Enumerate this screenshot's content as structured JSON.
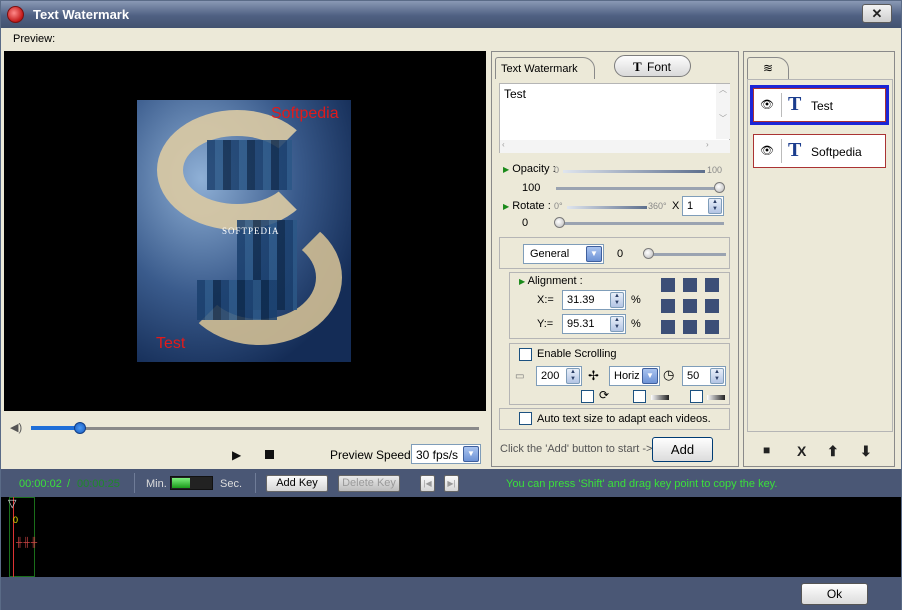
{
  "window": {
    "title": "Text Watermark",
    "close_glyph": "✕"
  },
  "menu": {
    "preview_label": "Preview:"
  },
  "preview": {
    "watermark_softpedia": "Softpedia",
    "watermark_test": "Test",
    "image_caption": "SOFTPEDIA",
    "seek_position": 0.11,
    "preview_speed_label": "Preview Speed:",
    "preview_speed_value": "30 fps/s",
    "watermark_color": "#e21a1a"
  },
  "tabs": {
    "text_watermark": "Text Watermark",
    "font": "Font",
    "font_icon": "T"
  },
  "text_editor": {
    "value": "Test"
  },
  "opacity": {
    "label": "Opacity",
    "min": "0",
    "max": "100",
    "value": "100",
    "level": 1.0
  },
  "rotate": {
    "label": "Rotate",
    "min": "0°",
    "max": "360°",
    "x_label": "X",
    "times_value": "1",
    "value": "0",
    "level": 0.0
  },
  "blend": {
    "mode": "General",
    "value": "0",
    "level": 0.0
  },
  "alignment": {
    "label": "Alignment :",
    "x_label": "X:=",
    "x_value": "31.39",
    "y_label": "Y:=",
    "y_value": "95.31",
    "unit": "%"
  },
  "scrolling": {
    "enable_label": "Enable Scrolling",
    "enabled": false,
    "distance": "200",
    "direction": "Horiz",
    "speed": "50"
  },
  "auto_size": {
    "label": "Auto text size to adapt each videos.",
    "checked": false
  },
  "add": {
    "hint": "Click the 'Add' button to start ->",
    "button": "Add"
  },
  "layers": {
    "items": [
      {
        "name": "Test",
        "selected": true
      },
      {
        "name": "Softpedia",
        "selected": false
      }
    ],
    "tools": {
      "lock": "🔒",
      "delete": "X",
      "up": "⬆",
      "down": "⬇"
    }
  },
  "timeline": {
    "current_time": "00:00:02",
    "separator": "/",
    "total_time": "00:00:25",
    "min_label": "Min.",
    "sec_label": "Sec.",
    "zoom_level": 0.45,
    "add_key": "Add Key",
    "delete_key": "Delete Key",
    "hint": "You can press 'Shift' and drag key point to copy the key.",
    "zero_mark": "0",
    "accent_color": "#3ae03a"
  },
  "footer": {
    "ok": "Ok"
  }
}
